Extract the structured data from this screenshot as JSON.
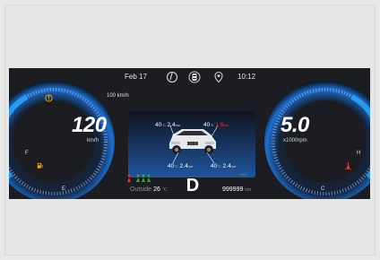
{
  "topbar": {
    "date": "Feb  17",
    "time": "10:12",
    "icons": [
      "steering-assist-icon",
      "car-top-icon",
      "location-pin-icon"
    ]
  },
  "speed": {
    "limit_label": "100 km/h",
    "value": "120",
    "unit": "km/h",
    "fuel_marks": {
      "full": "F",
      "empty": "E"
    }
  },
  "rpm": {
    "value": "5.0",
    "unit": "x1000rpm",
    "temp_marks": {
      "hot": "H",
      "cold": "C"
    }
  },
  "tires": {
    "front_left": {
      "temp": "40",
      "temp_unit": "°C",
      "pressure": "2.4",
      "pressure_unit": "bar"
    },
    "front_right": {
      "temp": "40",
      "temp_unit": "°C",
      "pressure": "1.6",
      "pressure_unit": "bar",
      "alert": true
    },
    "rear_left": {
      "temp": "40",
      "temp_unit": "°C",
      "pressure": "2.4",
      "pressure_unit": "bar"
    },
    "rear_right": {
      "temp": "40",
      "temp_unit": "°C",
      "pressure": "2.4",
      "pressure_unit": "bar"
    }
  },
  "status": {
    "outside_label": "Outside",
    "outside_temp": "26",
    "outside_unit": "°C",
    "gear": "D",
    "odometer": "999999",
    "odometer_unit": "km",
    "mode": "eco"
  },
  "colors": {
    "background": "#1b1d23",
    "accent_blue": "#1e88e5",
    "alert_red": "#e53935",
    "warning_amber": "#f5a623",
    "eco_green": "#43a047"
  }
}
